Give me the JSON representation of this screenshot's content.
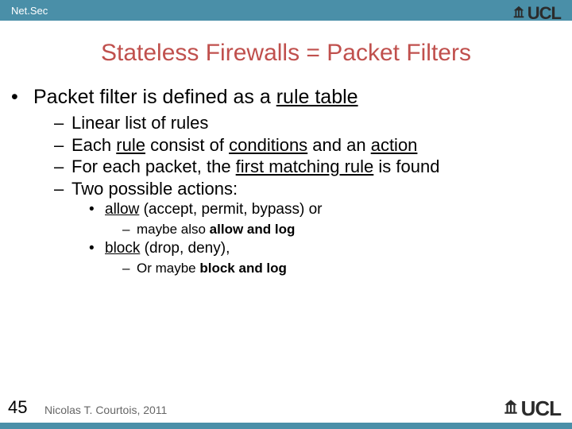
{
  "header": {
    "label": "Net.Sec"
  },
  "brand": "UCL",
  "title": "Stateless Firewalls = Packet Filters",
  "lvl1_prefix": "Packet filter is defined as a ",
  "lvl1_underlined": "rule table",
  "lvl2": [
    {
      "pre": "Linear list of rules",
      "u1": "",
      "mid": "",
      "u2": "",
      "post": ""
    },
    {
      "pre": "Each ",
      "u1": "rule",
      "mid": " consist of ",
      "u2": "conditions",
      "post": " and an ",
      "u3": "action"
    },
    {
      "pre": "For each packet, the ",
      "u1": "first matching rule",
      "mid": " is found",
      "u2": "",
      "post": ""
    },
    {
      "pre": "Two possible actions:",
      "u1": "",
      "mid": "",
      "u2": "",
      "post": ""
    }
  ],
  "lvl3a": {
    "u": "allow",
    "post": " (accept, permit, bypass) or"
  },
  "lvl4a": {
    "pre": "maybe also ",
    "b": "allow and log"
  },
  "lvl3b": {
    "u": "block",
    "post": " (drop, deny),"
  },
  "lvl4b": {
    "pre": "Or maybe ",
    "b": "block and log"
  },
  "page_number": "45",
  "footer": "Nicolas T. Courtois, 2011"
}
